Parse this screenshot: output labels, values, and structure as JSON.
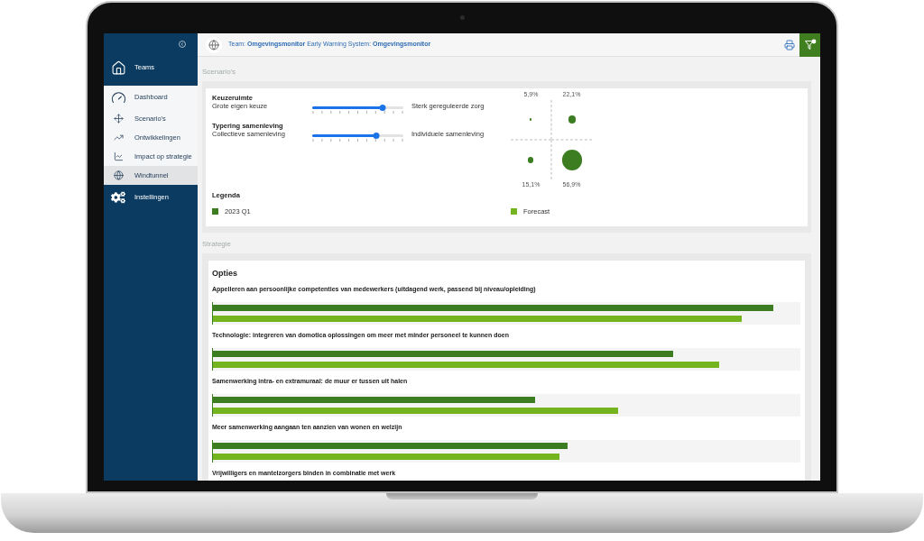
{
  "sidebar": {
    "teams": {
      "label": "Teams"
    },
    "items": [
      {
        "label": "Dashboard",
        "selected": false
      },
      {
        "label": "Scenario's",
        "selected": false
      },
      {
        "label": "Ontwikkelingen",
        "selected": false
      },
      {
        "label": "Impact op strategie",
        "selected": false
      },
      {
        "label": "Windtunnel",
        "selected": true
      }
    ],
    "settings": {
      "label": "Instellingen"
    }
  },
  "header": {
    "context": "Team: **Omgevingsmonitor** Early Warning System: **Omgevingsmonitor**"
  },
  "scenarios": {
    "title": "Scenario's",
    "sliders": [
      {
        "title": "Keuzeruimte",
        "left_label": "Grote eigen keuze",
        "right_label": "Sterk gereguleerde zorg",
        "level": 0.77
      },
      {
        "title": "Typering samenleving",
        "left_label": "Collectieve samenleving",
        "right_label": "Individuele samenleving",
        "level": 0.7
      }
    ],
    "quadrants": [
      {
        "label": "5,9%"
      },
      {
        "label": "22,1%"
      },
      {
        "label": "15,1%"
      },
      {
        "label": "56,9%"
      }
    ],
    "legend": {
      "title": "Legenda",
      "items": [
        {
          "label": "2023 Q1",
          "color": "#3c7d22"
        },
        {
          "label": "Forecast",
          "color": "#74b41f"
        }
      ]
    }
  },
  "strategy": {
    "title": "Strategie",
    "card_title": "Opties",
    "options": [
      {
        "label": "Appelleren aan persoonlijke competenties van medewerkers (uitdagend werk, passend bij niveau/opleiding)",
        "bars": [
          {
            "level": 0.954
          },
          {
            "level": 0.9
          }
        ]
      },
      {
        "label": "Technologie: integreren van domotica oplossingen om meer met minder personeel te kunnen doen",
        "bars": [
          {
            "level": 0.784
          },
          {
            "level": 0.862
          }
        ]
      },
      {
        "label": "Samenwerking intra- en extramuraal: de muur er tussen uit halen",
        "bars": [
          {
            "level": 0.548
          },
          {
            "level": 0.689
          }
        ]
      },
      {
        "label": "Meer samenwerking aangaan ten aanzien van wonen en welzijn",
        "bars": [
          {
            "level": 0.603
          },
          {
            "level": 0.59
          }
        ]
      },
      {
        "label": "Vrijwilligers en mantelzorgers binden in combinatie met werk"
      }
    ]
  }
}
